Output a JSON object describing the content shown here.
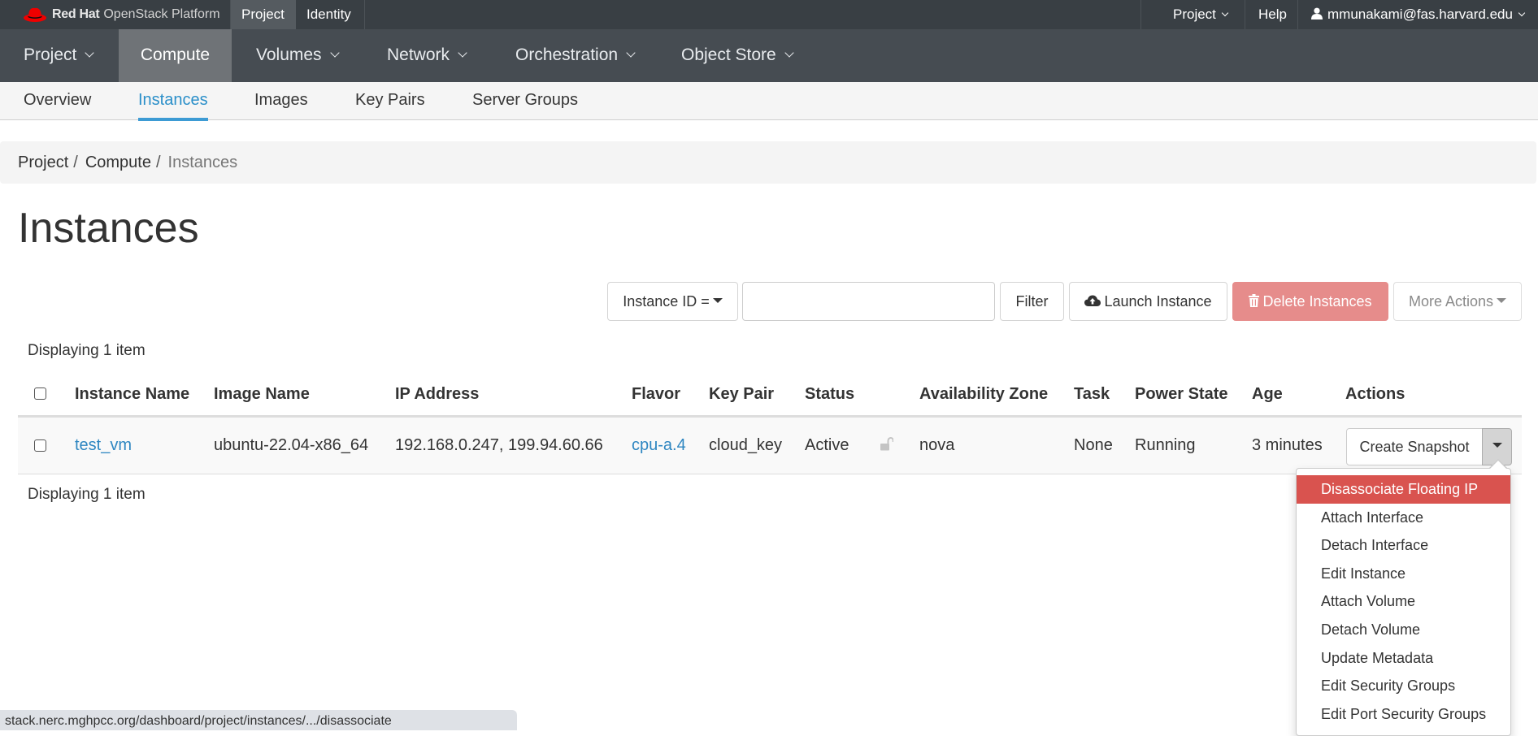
{
  "topbar": {
    "brand_bold": "Red Hat",
    "brand_light": "OpenStack Platform",
    "tabs": [
      {
        "label": "Project",
        "active": true
      },
      {
        "label": "Identity",
        "active": false
      }
    ],
    "project_menu": "Project",
    "help": "Help",
    "user": "mmunakami@fas.harvard.edu",
    "icons": {
      "logo": "redhat-hat-icon",
      "user": "user-icon",
      "chevron": "chevron-down-icon"
    }
  },
  "mainnav": {
    "items": [
      {
        "label": "Project",
        "dropdown": true,
        "active": false
      },
      {
        "label": "Compute",
        "dropdown": false,
        "active": true
      },
      {
        "label": "Volumes",
        "dropdown": true,
        "active": false
      },
      {
        "label": "Network",
        "dropdown": true,
        "active": false
      },
      {
        "label": "Orchestration",
        "dropdown": true,
        "active": false
      },
      {
        "label": "Object Store",
        "dropdown": true,
        "active": false
      }
    ]
  },
  "subnav": {
    "items": [
      {
        "label": "Overview",
        "active": false
      },
      {
        "label": "Instances",
        "active": true
      },
      {
        "label": "Images",
        "active": false
      },
      {
        "label": "Key Pairs",
        "active": false
      },
      {
        "label": "Server Groups",
        "active": false
      }
    ]
  },
  "breadcrumb": [
    "Project",
    "Compute",
    "Instances"
  ],
  "breadcrumb_separator": "/",
  "page_title": "Instances",
  "toolbar": {
    "filter_field": "Instance ID =",
    "filter_value": "",
    "filter_button": "Filter",
    "launch_button": "Launch Instance",
    "delete_button": "Delete Instances",
    "more_actions": "More Actions",
    "icons": {
      "launch": "cloud-upload-icon",
      "delete": "trash-icon",
      "caret": "caret-down-icon"
    }
  },
  "table": {
    "displaying_top": "Displaying 1 item",
    "displaying_bottom": "Displaying 1 item",
    "columns": [
      "Instance Name",
      "Image Name",
      "IP Address",
      "Flavor",
      "Key Pair",
      "Status",
      "Availability Zone",
      "Task",
      "Power State",
      "Age",
      "Actions"
    ],
    "rows": [
      {
        "instance_name": "test_vm",
        "image_name": "ubuntu-22.04-x86_64",
        "ip_address": "192.168.0.247, 199.94.60.66",
        "flavor": "cpu-a.4",
        "key_pair": "cloud_key",
        "status": "Active",
        "lock_icon": "unlock-icon",
        "availability_zone": "nova",
        "task": "None",
        "power_state": "Running",
        "age": "3 minutes",
        "action_primary": "Create Snapshot"
      }
    ]
  },
  "action_menu": {
    "open": true,
    "items": [
      {
        "label": "Disassociate Floating IP",
        "highlighted": true
      },
      {
        "label": "Attach Interface"
      },
      {
        "label": "Detach Interface"
      },
      {
        "label": "Edit Instance"
      },
      {
        "label": "Attach Volume"
      },
      {
        "label": "Detach Volume"
      },
      {
        "label": "Update Metadata"
      },
      {
        "label": "Edit Security Groups"
      },
      {
        "label": "Edit Port Security Groups"
      }
    ]
  },
  "statusbar": {
    "url": "stack.nerc.mghpcc.org/dashboard/project/instances/.../disassociate"
  },
  "colors": {
    "topbar_bg": "#393f44",
    "mainnav_bg": "#464c52",
    "mainnav_active": "#6f7377",
    "link": "#2e86c1",
    "active_tab": "#3d9bd4",
    "danger": "#d9534f",
    "danger_disabled": "#e68c8b",
    "redhat_red": "#ee0000"
  }
}
